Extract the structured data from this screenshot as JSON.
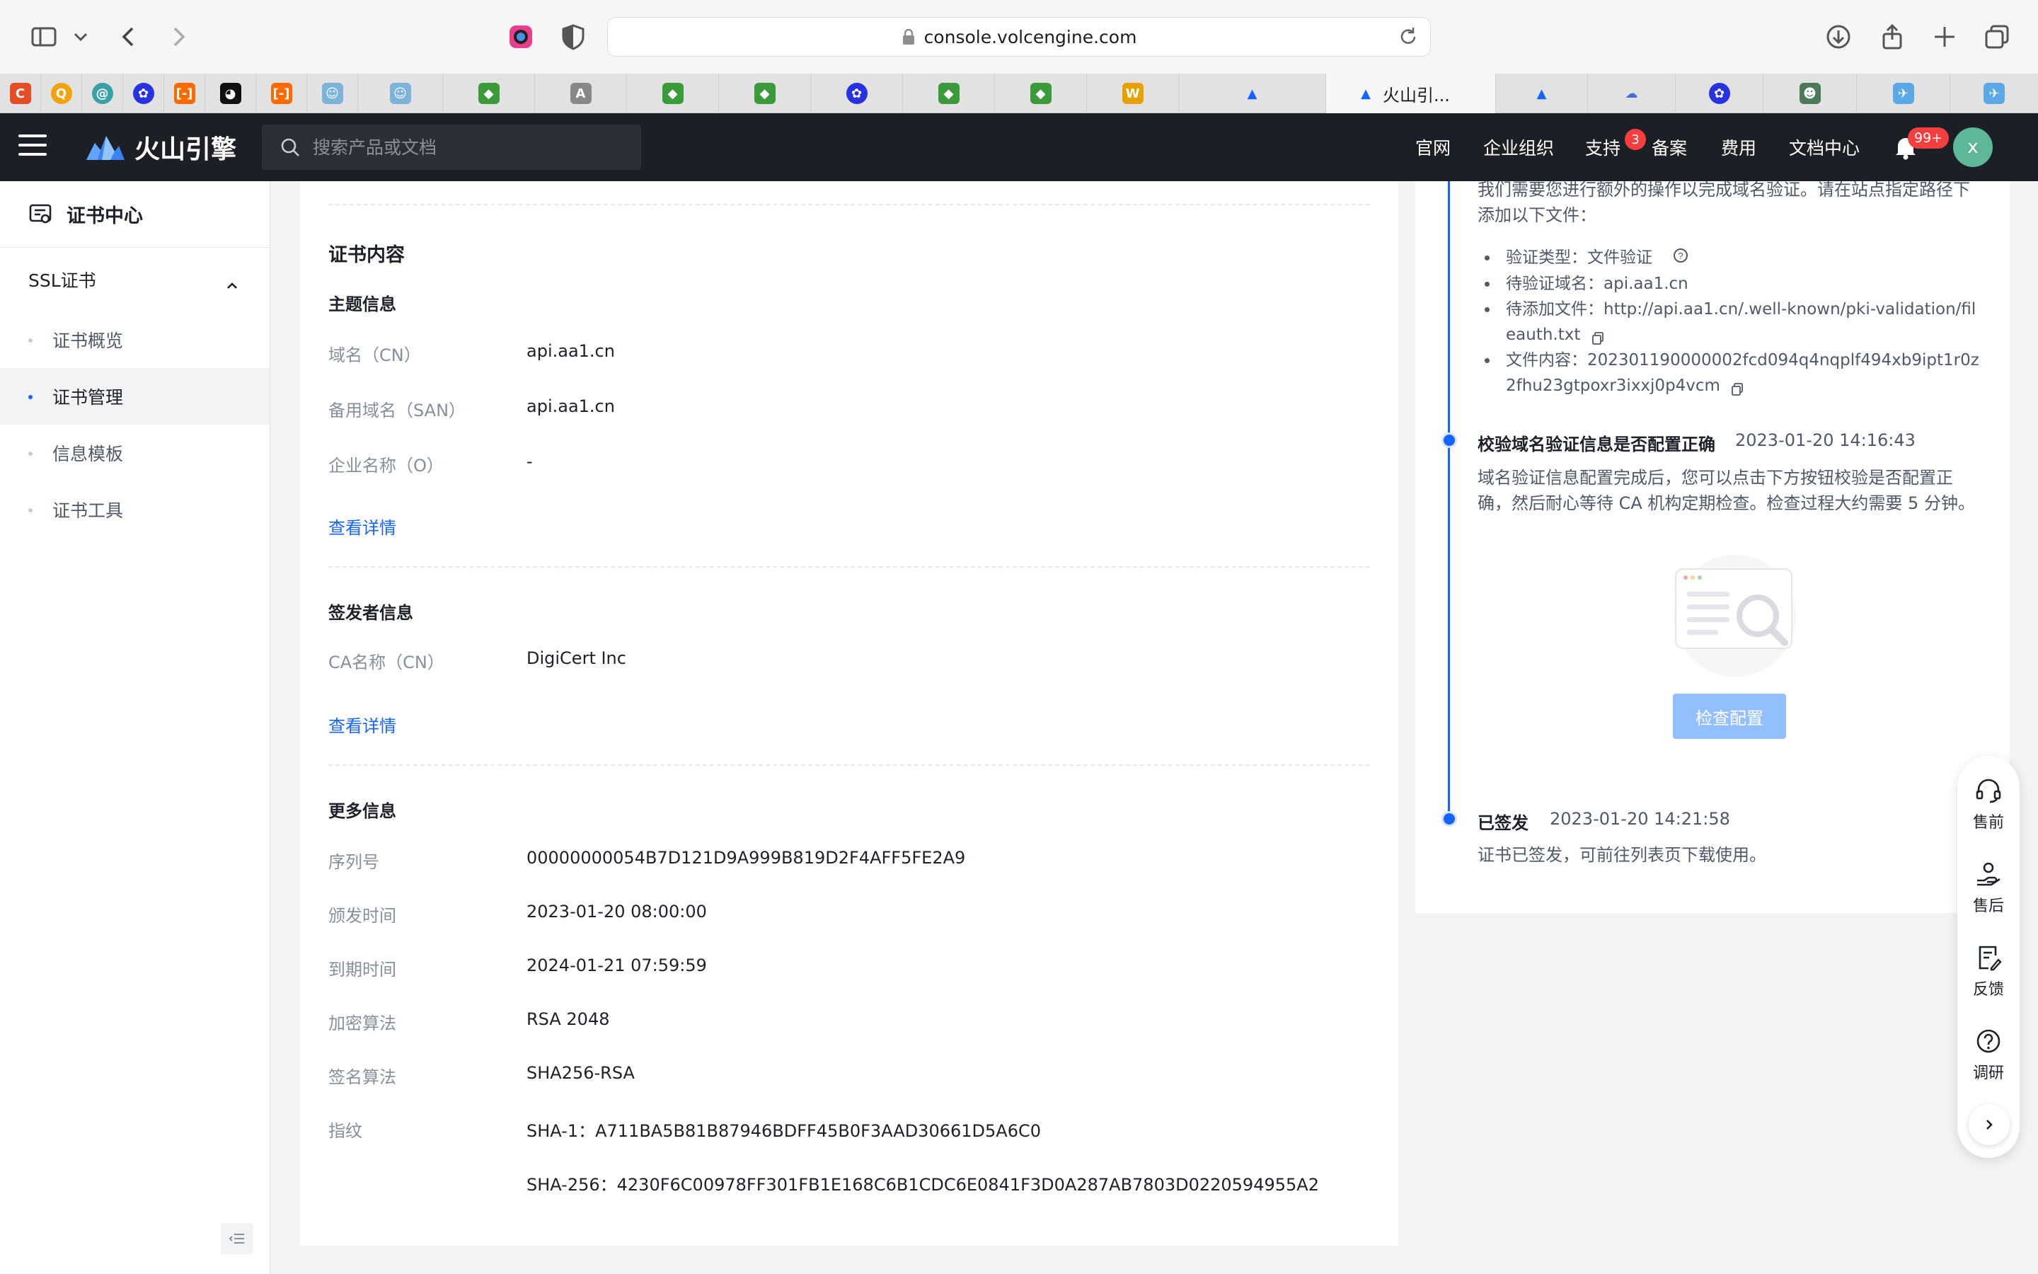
{
  "browser": {
    "url": "console.volcengine.com",
    "active_tab_title": "火山引..."
  },
  "header": {
    "brand": "火山引擎",
    "search_placeholder": "搜索产品或文档",
    "nav": {
      "official_site": "官网",
      "org": "企业组织",
      "support": "支持",
      "support_badge": "3",
      "filing": "备案",
      "billing": "费用",
      "docs": "文档中心",
      "notifications_badge": "99+",
      "avatar_initial": "x"
    }
  },
  "sidebar": {
    "title": "证书中心",
    "group": "SSL证书",
    "items": [
      {
        "label": "证书概览"
      },
      {
        "label": "证书管理"
      },
      {
        "label": "信息模板"
      },
      {
        "label": "证书工具"
      }
    ]
  },
  "main": {
    "section_title": "证书内容",
    "subject": {
      "title": "主题信息",
      "rows": [
        {
          "label": "域名（CN）",
          "value": "api.aa1.cn"
        },
        {
          "label": "备用域名（SAN）",
          "value": "api.aa1.cn"
        },
        {
          "label": "企业名称（O）",
          "value": "-"
        }
      ],
      "link": "查看详情"
    },
    "issuer": {
      "title": "签发者信息",
      "rows": [
        {
          "label": "CA名称（CN）",
          "value": "DigiCert Inc"
        }
      ],
      "link": "查看详情"
    },
    "more": {
      "title": "更多信息",
      "rows": [
        {
          "label": "序列号",
          "value": "00000000054B7D121D9A999B819D2F4AFF5FE2A9"
        },
        {
          "label": "颁发时间",
          "value": "2023-01-20 08:00:00"
        },
        {
          "label": "到期时间",
          "value": "2024-01-21 07:59:59"
        },
        {
          "label": "加密算法",
          "value": "RSA 2048"
        },
        {
          "label": "签名算法",
          "value": "SHA256-RSA"
        },
        {
          "label": "指纹",
          "value": "SHA-1：A711BA5B81B87946BDFF45B0F3AAD30661D5A6C0"
        },
        {
          "label": "",
          "value": "SHA-256：4230F6C00978FF301FB1E168C6B1CDC6E0841F3D0A287AB7803D0220594955A2"
        }
      ]
    }
  },
  "timeline": {
    "intro_line1": "我们需要您进行额外的操作以完成域名验证。请在站点指定路径下",
    "intro_line2": "添加以下文件：",
    "bullets": [
      "验证类型：文件验证",
      "待验证域名：api.aa1.cn",
      "待添加文件：http://api.aa1.cn/.well-known/pki-validation/fil",
      "eauth.txt",
      "文件内容：202301190000002fcd094q4nqplf494xb9ipt1r0z",
      "2fhu23gtpoxr3ixxj0p4vcm"
    ],
    "step2": {
      "title": "校验域名验证信息是否配置正确",
      "time": "2023-01-20 14:16:43",
      "desc_line1": "域名验证信息配置完成后，您可以点击下方按钮校验是否配置正",
      "desc_line2": "确，然后耐心等待 CA 机构定期检查。检查过程大约需要 5 分钟。",
      "button": "检查配置"
    },
    "step3": {
      "title": "已签发",
      "time": "2023-01-20 14:21:58",
      "desc": "证书已签发，可前往列表页下载使用。"
    }
  },
  "float_help": {
    "presale": "售前",
    "aftersale": "售后",
    "feedback": "反馈",
    "survey": "调研"
  },
  "colors": {
    "primary": "#1664ff",
    "header_bg": "#1c1f26",
    "button_disabled": "#94bfff",
    "badge": "#f53f3f"
  }
}
